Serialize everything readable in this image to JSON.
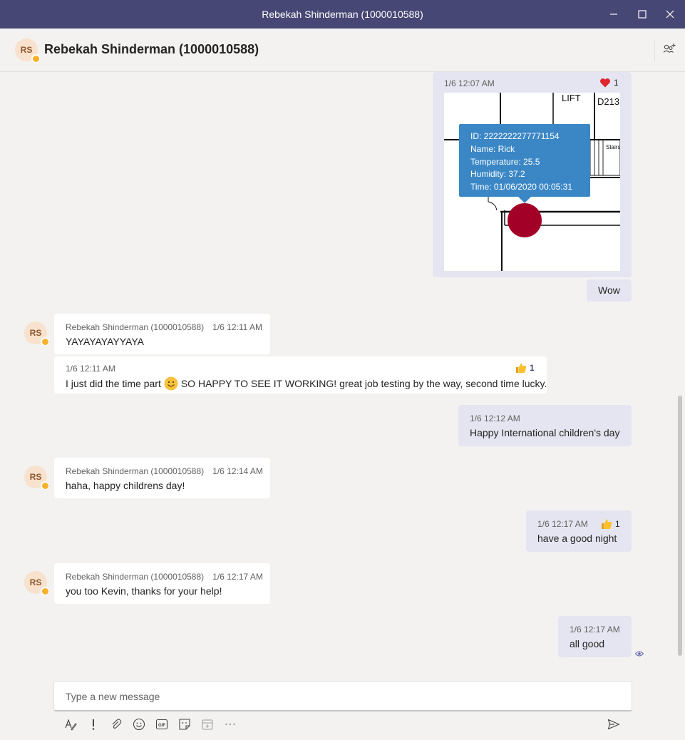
{
  "window": {
    "title": "Rebekah Shinderman (1000010588)"
  },
  "header": {
    "avatar_initials": "RS",
    "name": "Rebekah Shinderman (1000010588)"
  },
  "messages": [
    {
      "time": "1/6 12:07 AM",
      "reaction_icon": "heart-icon",
      "reaction_count": "1",
      "image": {
        "labels": {
          "lift": "LIFT",
          "room": "D213",
          "stairs": "Stairs"
        },
        "tooltip": [
          "ID: 2222222277771154",
          "Name: Rick",
          "Temperature: 25.5",
          "Humidity: 37.2",
          "Time: 01/06/2020 00:05:31"
        ]
      }
    },
    {
      "text": "Wow"
    },
    {
      "author": "Rebekah Shinderman (1000010588)",
      "time": "1/6 12:11 AM",
      "text": "YAYAYAYAYYAYA",
      "avatar_initials": "RS"
    },
    {
      "time": "1/6 12:11 AM",
      "text_before": "I just did the time part",
      "text_after": "SO HAPPY TO SEE IT WORKING! great job testing by the way, second time lucky.",
      "reaction_icon": "thumbs-up-icon",
      "reaction_count": "1"
    },
    {
      "time": "1/6 12:12 AM",
      "text": "Happy International children's day"
    },
    {
      "author": "Rebekah Shinderman (1000010588)",
      "time": "1/6 12:14 AM",
      "text": "haha, happy childrens day!",
      "avatar_initials": "RS"
    },
    {
      "time": "1/6 12:17 AM",
      "text": "have a good night",
      "reaction_icon": "thumbs-up-icon",
      "reaction_count": "1"
    },
    {
      "author": "Rebekah Shinderman (1000010588)",
      "time": "1/6 12:17 AM",
      "text": "you too Kevin, thanks for your help!",
      "avatar_initials": "RS"
    },
    {
      "time": "1/6 12:17 AM",
      "text": "all good"
    }
  ],
  "compose": {
    "placeholder": "Type a new message",
    "toolbar_icons": [
      "format-icon",
      "important-icon",
      "attach-icon",
      "emoji-icon",
      "gif-icon",
      "sticker-icon",
      "schedule-meeting-icon",
      "more-options-icon"
    ]
  },
  "colors": {
    "titlebar": "#464775",
    "my_bubble": "#e5e5f1",
    "their_bubble": "#ffffff",
    "accent": "#6264a7",
    "tooltip": "#3b87c6",
    "sensor_dot": "#a30027"
  }
}
